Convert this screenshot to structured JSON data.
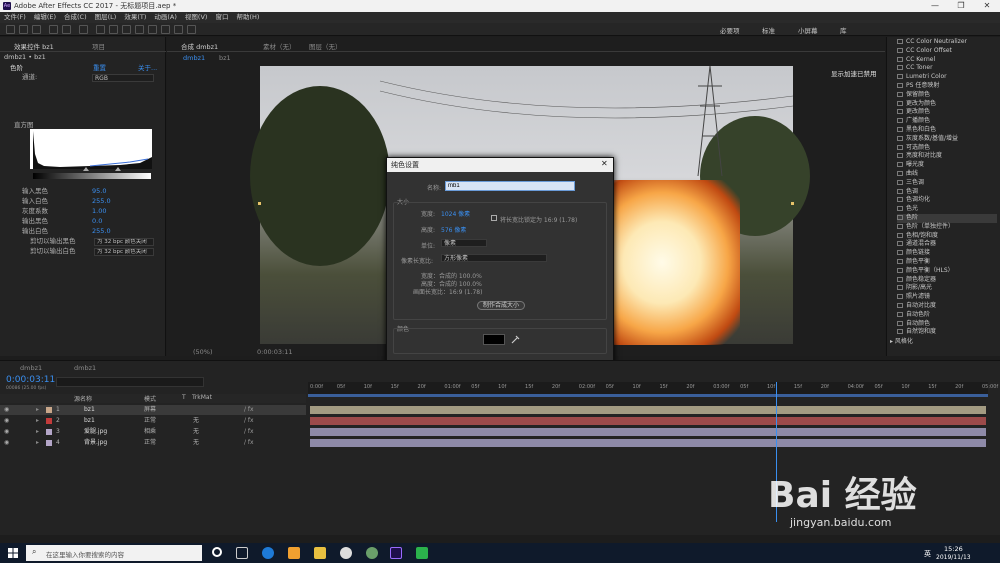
{
  "titlebar": {
    "title": "Adobe After Effects CC 2017 - 无标题项目.aep *",
    "minimize": "—",
    "maximize": "❐",
    "close": "✕",
    "app_badge": "Ae"
  },
  "menu": [
    "文件(F)",
    "编辑(E)",
    "合成(C)",
    "图层(L)",
    "效果(T)",
    "动画(A)",
    "视图(V)",
    "窗口",
    "帮助(H)"
  ],
  "workspaces": [
    "必要项",
    "标准",
    "小屏幕",
    "库"
  ],
  "left_panel": {
    "tab_effects": "效果控件 bz1",
    "tab_project": "项目",
    "breadcrumb": "dmbz1 • bz1",
    "effect_name": "色阶",
    "reset": "重置",
    "about": "关于...",
    "channel_label": "通道:",
    "channel_value": "RGB",
    "histogram_label": "直方图",
    "params": [
      {
        "label": "输入黑色",
        "value": "95.0"
      },
      {
        "label": "输入白色",
        "value": "255.0"
      },
      {
        "label": "灰度系数",
        "value": "1.00"
      },
      {
        "label": "输出黑色",
        "value": "0.0"
      },
      {
        "label": "输出白色",
        "value": "255.0"
      }
    ],
    "clip_black_label": "剪切以输出黑色",
    "clip_black_value": "为 32 bpc 颜色关闭",
    "clip_white_label": "剪切以输出白色",
    "clip_white_value": "为 32 bpc 颜色关闭"
  },
  "viewer": {
    "comp_tab": "合成 dmbz1",
    "layer_tab": "素材（无）",
    "layer_tab2": "图层（无）",
    "sub_tabs": [
      "dmbz1",
      "bz1"
    ],
    "gpu_note": "显示加速已禁用",
    "zoom": "(50%)",
    "timecode": "0:00:03:11"
  },
  "effects_list": [
    "CC Color Neutralizer",
    "CC Color Offset",
    "CC Kernel",
    "CC Toner",
    "Lumetri Color",
    "PS 任意映射",
    "保留颜色",
    "更改为颜色",
    "更改颜色",
    "广播颜色",
    "黑色和白色",
    "灰度系数/基值/增益",
    "可选颜色",
    "亮度和对比度",
    "曝光度",
    "曲线",
    "三色调",
    "色调",
    "色调均化",
    "色光",
    "色阶",
    "色阶（单独控件）",
    "色相/饱和度",
    "通道混合器",
    "颜色链接",
    "颜色平衡",
    "颜色平衡（HLS）",
    "颜色稳定器",
    "阴影/高光",
    "照片滤镜",
    "自动对比度",
    "自动色阶",
    "自动颜色",
    "自然饱和度"
  ],
  "effects_group": "风格化",
  "dialog": {
    "title": "纯色设置",
    "close": "✕",
    "name_label": "名称:",
    "name_value": "mb1",
    "size_section": "大小",
    "width_label": "宽度:",
    "width_value": "1024 像素",
    "lock_ratio_label": "将长宽比锁定为 16:9 (1.78)",
    "height_label": "高度:",
    "height_value": "576 像素",
    "unit_label": "单位:",
    "unit_value": "像素",
    "pixel_ratio_label": "像素长宽比:",
    "pixel_ratio_value": "方形像素",
    "info_width": "宽度：合成的 100.0%",
    "info_height": "高度：合成的 100.0%",
    "info_ratio": "画面长宽比：16:9 (1.78)",
    "make_comp_size": "制作合成大小",
    "color_section": "颜色",
    "preview_label": "预览",
    "ok": "确定",
    "cancel": "取消",
    "swatch_color": "#000000"
  },
  "timeline": {
    "tab_active": "dmbz1",
    "tab_inactive": "dmbz1",
    "timecode": "0:00:03:11",
    "frame_info": "00086 (25.00 fps)",
    "col_source": "源名称",
    "col_mode": "模式",
    "col_t": "T",
    "col_trkmat": "TrkMat",
    "ruler": [
      "0:00f",
      "05f",
      "10f",
      "15f",
      "20f",
      "01:00f",
      "05f",
      "10f",
      "15f",
      "20f",
      "02:00f",
      "05f",
      "10f",
      "15f",
      "20f",
      "03:00f",
      "05f",
      "10f",
      "15f",
      "20f",
      "04:00f",
      "05f",
      "10f",
      "15f",
      "20f",
      "05:00f"
    ],
    "layers": [
      {
        "num": "1",
        "name": "bz1",
        "mode": "屏幕",
        "trkmat": "",
        "color": "#c9a78a",
        "bar": "#a39b82"
      },
      {
        "num": "2",
        "name": "bz1",
        "mode": "正常",
        "trkmat": "无",
        "color": "#c23b3b",
        "bar": "#9c4a4a"
      },
      {
        "num": "3",
        "name": "爱腿.jpg",
        "mode": "相乘",
        "trkmat": "无",
        "color": "#b4a6c8",
        "bar": "#8e8aa8"
      },
      {
        "num": "4",
        "name": "背景.jpg",
        "mode": "正常",
        "trkmat": "无",
        "color": "#b4a6c8",
        "bar": "#8e8aa8"
      }
    ]
  },
  "taskbar": {
    "search_placeholder": "在这里输入你要搜索的内容",
    "time": "15:26",
    "date": "2019/11/13",
    "lang": "英"
  },
  "watermark": {
    "brand": "Bai 经验",
    "url": "jingyan.baidu.com"
  }
}
